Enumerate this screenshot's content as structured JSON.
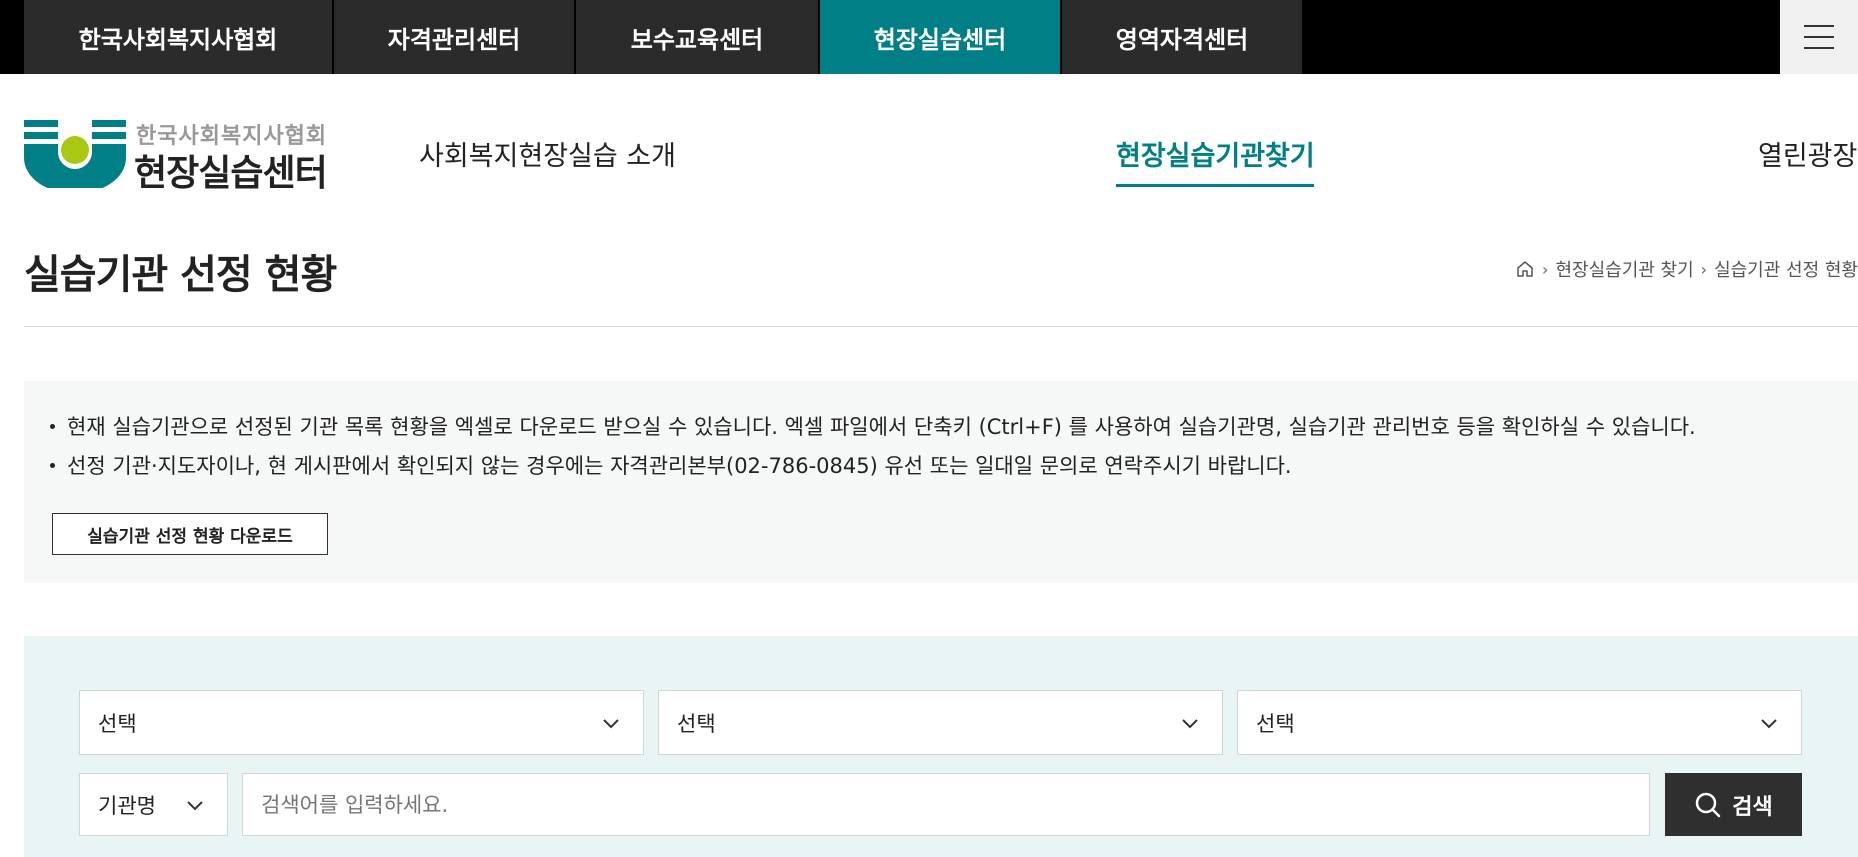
{
  "top_tabs": [
    {
      "label": "한국사회복지사협회"
    },
    {
      "label": "자격관리센터"
    },
    {
      "label": "보수교육센터"
    },
    {
      "label": "현장실습센터"
    },
    {
      "label": "영역자격센터"
    }
  ],
  "header": {
    "logo_sub": "한국사회복지사협회",
    "logo_main": "현장실습센터",
    "nav": [
      "사회복지현장실습 소개",
      "현장실습기관찾기",
      "열린광장"
    ]
  },
  "page": {
    "title": "실습기관 선정 현황",
    "breadcrumb": [
      "현장실습기관 찾기",
      "실습기관 선정 현황"
    ]
  },
  "info": {
    "lines": [
      "현재 실습기관으로 선정된 기관 목록 현황을 엑셀로 다운로드 받으실 수 있습니다. 엑셀 파일에서 단축키 (Ctrl+F) 를 사용하여 실습기관명, 실습기관 관리번호 등을 확인하실 수 있습니다.",
      "선정 기관·지도자이나, 현 게시판에서 확인되지 않는 경우에는 자격관리본부(02-786-0845) 유선 또는 일대일 문의로 연락주시기 바랍니다."
    ],
    "download_label": "실습기관 선정 현황 다운로드"
  },
  "search": {
    "selects": [
      "선택",
      "선택",
      "선택"
    ],
    "type_select": "기관명",
    "placeholder": "검색어를 입력하세요.",
    "button_label": "검색"
  },
  "colors": {
    "accent": "#007f86",
    "dark": "#2b2b2b"
  }
}
